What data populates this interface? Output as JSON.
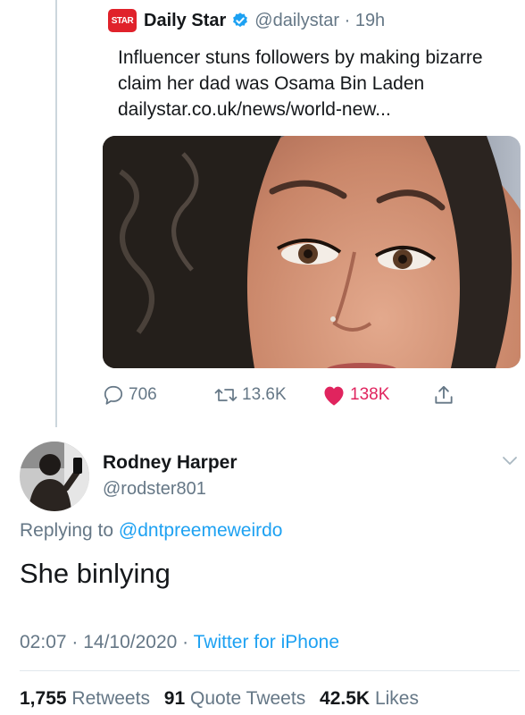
{
  "colors": {
    "link": "#1da1f2",
    "secondary": "#657786",
    "like": "#e0245e",
    "brand": "#e0222b"
  },
  "quoted_tweet": {
    "logo_text": "STAR",
    "name": "Daily Star",
    "handle_time": "@dailystar · 19h",
    "text": "Influencer stuns followers by making bizarre claim her dad was Osama Bin Laden dailystar.co.uk/news/world-new...",
    "actions": {
      "replies": "706",
      "retweets": "13.6K",
      "likes": "138K"
    }
  },
  "reply_tweet": {
    "name": "Rodney Harper",
    "handle": "@rodster801",
    "replying_prefix": "Replying to",
    "replying_to": "@dntpreemeweirdo",
    "text": "She binlying",
    "timestamp": "02:07 · 14/10/2020 · ",
    "source": "Twitter for iPhone",
    "stats": {
      "retweets_count": "1,755",
      "retweets_label": "Retweets",
      "quotes_count": "91",
      "quotes_label": "Quote Tweets",
      "likes_count": "42.5K",
      "likes_label": "Likes"
    }
  }
}
